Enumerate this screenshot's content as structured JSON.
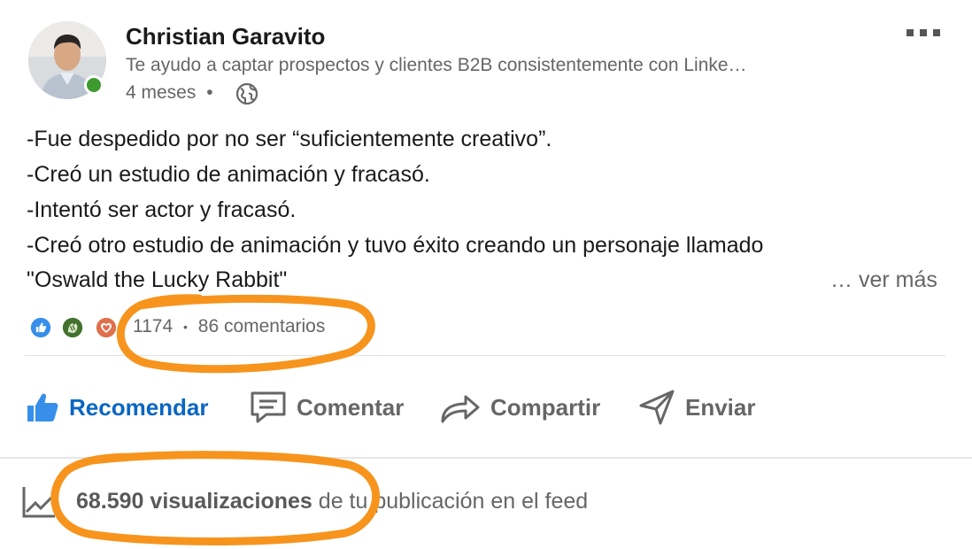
{
  "post": {
    "author": {
      "name": "Christian Garavito",
      "headline": "Te ayudo a captar prospectos y clientes B2B consistentemente con Linke…",
      "time": "4 meses",
      "separator": "•",
      "online_color": "#3e9a2e"
    },
    "body_lines": [
      "-Fue despedido por no ser “suficientemente creativo”.",
      "-Creó un estudio de animación y fracasó.",
      "-Intentó ser actor y fracasó.",
      "-Creó otro estudio de animación y tuvo éxito creando un personaje llamado",
      "\"Oswald the Lucky Rabbit\""
    ],
    "see_more_label": "… ver más",
    "reactions": {
      "icons": [
        "like-icon",
        "celebrate-icon",
        "love-icon"
      ],
      "count": "1174",
      "separator": "•",
      "comments": "86 comentarios"
    },
    "actions": [
      {
        "label": "Recomendar",
        "icon": "thumbs-up-icon",
        "color": "#0a66c2"
      },
      {
        "label": "Comentar",
        "icon": "comment-icon",
        "color": "#666666"
      },
      {
        "label": "Compartir",
        "icon": "share-icon",
        "color": "#666666"
      },
      {
        "label": "Enviar",
        "icon": "send-icon",
        "color": "#666666"
      }
    ],
    "analytics": {
      "views_bold": "68.590 visualizaciones",
      "views_rest": " de tu publicación en el feed"
    },
    "annotation_color": "#f7941d"
  }
}
